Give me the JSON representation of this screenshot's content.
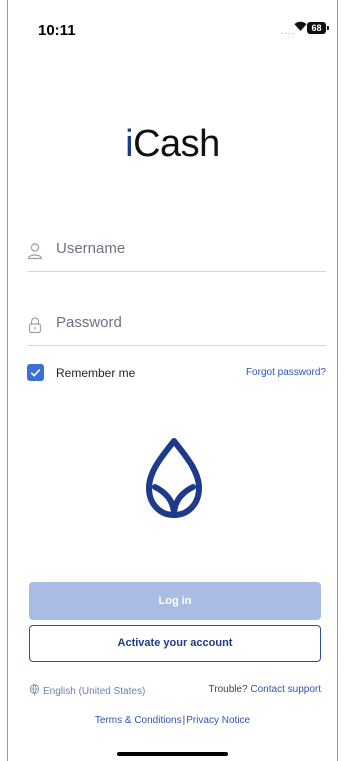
{
  "status_bar": {
    "time": "10:11",
    "signal": "....",
    "battery": "68"
  },
  "app": {
    "logo_prefix": "i",
    "logo_rest": "Cash"
  },
  "login_form": {
    "username_placeholder": "Username",
    "password_placeholder": "Password",
    "remember_label": "Remember me",
    "remember_checked": true,
    "forgot_label": "Forgot password?"
  },
  "buttons": {
    "login": "Log in",
    "activate": "Activate your account"
  },
  "footer": {
    "language": "English (United States)",
    "trouble": "Trouble?",
    "contact": "Contact support",
    "terms": "Terms & Conditions",
    "separator": "|",
    "privacy": "Privacy Notice"
  },
  "colors": {
    "brand": "#1e3a8a",
    "accent": "#3b6fd6",
    "login_disabled": "#a9bde4",
    "link": "#2f55b8"
  },
  "icons": [
    "user-icon",
    "lock-icon",
    "check-icon",
    "bank-logo-icon",
    "globe-icon",
    "wifi-icon",
    "battery-icon"
  ]
}
